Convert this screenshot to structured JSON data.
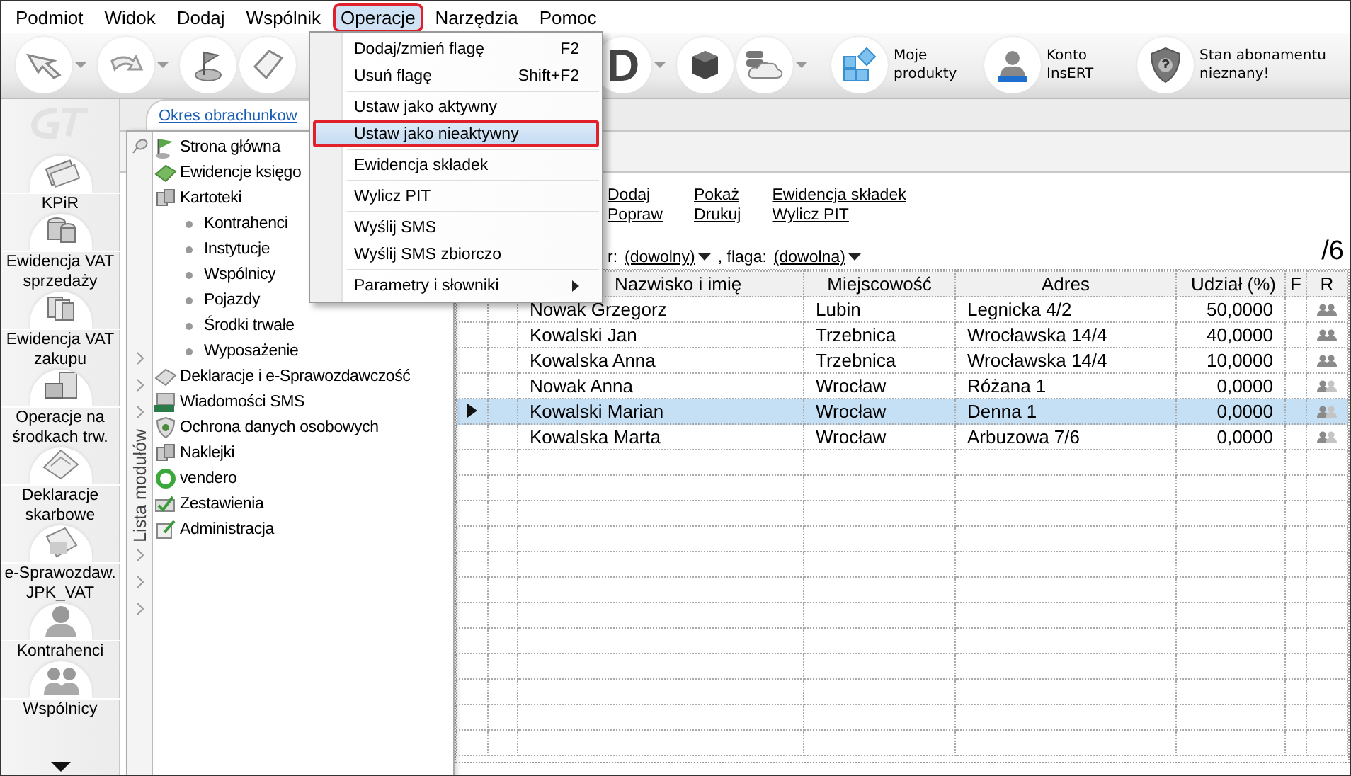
{
  "menubar": [
    {
      "label": "Podmiot",
      "selected": false
    },
    {
      "label": "Widok",
      "selected": false
    },
    {
      "label": "Dodaj",
      "selected": false
    },
    {
      "label": "Wspólnik",
      "selected": false
    },
    {
      "label": "Operacje",
      "selected": true
    },
    {
      "label": "Narzędzia",
      "selected": false
    },
    {
      "label": "Pomoc",
      "selected": false
    }
  ],
  "menu": {
    "items": [
      {
        "label": "Dodaj/zmień flagę",
        "shortcut": "F2",
        "kind": "item",
        "highlighted": false,
        "separator_before": false
      },
      {
        "label": "Usuń flagę",
        "shortcut": "Shift+F2",
        "kind": "item",
        "highlighted": false,
        "separator_before": false
      },
      {
        "label": "Ustaw jako aktywny",
        "kind": "item",
        "highlighted": false,
        "separator_before": true
      },
      {
        "label": "Ustaw jako nieaktywny",
        "kind": "item",
        "highlighted": true,
        "separator_before": false
      },
      {
        "label": "Ewidencja składek",
        "kind": "item",
        "highlighted": false,
        "separator_before": true
      },
      {
        "label": "Wylicz PIT",
        "kind": "item",
        "highlighted": false,
        "separator_before": true
      },
      {
        "label": "Wyślij SMS",
        "kind": "item",
        "highlighted": false,
        "separator_before": true
      },
      {
        "label": "Wyślij SMS zbiorczo",
        "kind": "item",
        "highlighted": false,
        "separator_before": false
      },
      {
        "label": "Parametry i słowniki",
        "kind": "submenu",
        "highlighted": false,
        "separator_before": true
      }
    ]
  },
  "toolbar": {
    "buttons": [
      {
        "kind": "back",
        "dropdown": true
      },
      {
        "kind": "forward",
        "dropdown": true
      },
      {
        "kind": "flag",
        "dropdown": false
      },
      {
        "kind": "tag",
        "dropdown": false
      },
      {
        "kind": "letter",
        "text": "D",
        "dropdown": true
      },
      {
        "kind": "cube",
        "dropdown": false
      },
      {
        "kind": "cloud",
        "dropdown": true
      },
      {
        "kind": "products",
        "label": "Moje produkty",
        "dropdown": false
      },
      {
        "kind": "account",
        "label": "Konto InsERT",
        "dropdown": false
      },
      {
        "kind": "shield",
        "label": "Stan abonamentu nieznany!",
        "dropdown": false
      }
    ]
  },
  "side_nav": {
    "items": [
      {
        "label": "KPiR"
      },
      {
        "label": "Ewidencja VAT sprzedaży"
      },
      {
        "label": "Ewidencja VAT zakupu"
      },
      {
        "label": "Operacje na środkach trw."
      },
      {
        "label": "Deklaracje skarbowe"
      },
      {
        "label": "e-Sprawozdaw. JPK_VAT"
      },
      {
        "label": "Kontrahenci"
      },
      {
        "label": "Wspólnicy"
      }
    ]
  },
  "tab": {
    "label": "Okres obrachunkow"
  },
  "module_tree": {
    "title": "Lista modułów",
    "items": [
      {
        "label": "Strona główna"
      },
      {
        "label": "Ewidencje księgo"
      },
      {
        "label": "Kartoteki",
        "children": [
          {
            "label": "Kontrahenci"
          },
          {
            "label": "Instytucje"
          },
          {
            "label": "Wspólnicy"
          },
          {
            "label": "Pojazdy"
          },
          {
            "label": "Środki trwałe"
          },
          {
            "label": "Wyposażenie"
          }
        ]
      },
      {
        "label": "Deklaracje i e-Sprawozdawczość"
      },
      {
        "label": "Wiadomości SMS"
      },
      {
        "label": "Ochrona danych osobowych"
      },
      {
        "label": "Naklejki"
      },
      {
        "label": "vendero"
      },
      {
        "label": "Zestawienia"
      },
      {
        "label": "Administracja"
      }
    ]
  },
  "actions": [
    [
      "Dodaj",
      "Popraw"
    ],
    [
      "Pokaż",
      "Drukuj"
    ],
    [
      "Ewidencja składek",
      "Wylicz PIT"
    ]
  ],
  "filter": {
    "label": "r:",
    "value": "(dowolny)",
    "flag_label": ", flaga:",
    "flag_value": "(dowolna)"
  },
  "count": "/6",
  "table": {
    "columns": [
      "Nazwisko i imię",
      "Miejscowość",
      "Adres",
      "Udział (%)",
      "F",
      "R"
    ],
    "rows": [
      {
        "cells": [
          "Nowak Grzegorz",
          "Lubin",
          "Legnicka 4/2",
          "50,0000"
        ],
        "r_filled": true,
        "selected": false
      },
      {
        "cells": [
          "Kowalski Jan",
          "Trzebnica",
          "Wrocławska 14/4",
          "40,0000"
        ],
        "r_filled": true,
        "selected": false
      },
      {
        "cells": [
          "Kowalska Anna",
          "Trzebnica",
          "Wrocławska 14/4",
          "10,0000"
        ],
        "r_filled": true,
        "selected": false
      },
      {
        "cells": [
          "Nowak Anna",
          "Wrocław",
          "Różana 1",
          "0,0000"
        ],
        "r_filled": false,
        "selected": false
      },
      {
        "cells": [
          "Kowalski Marian",
          "Wrocław",
          "Denna 1",
          "0,0000"
        ],
        "r_filled": false,
        "selected": true
      },
      {
        "cells": [
          "Kowalska Marta",
          "Wrocław",
          "Arbuzowa 7/6",
          "0,0000"
        ],
        "r_filled": false,
        "selected": false
      }
    ]
  }
}
